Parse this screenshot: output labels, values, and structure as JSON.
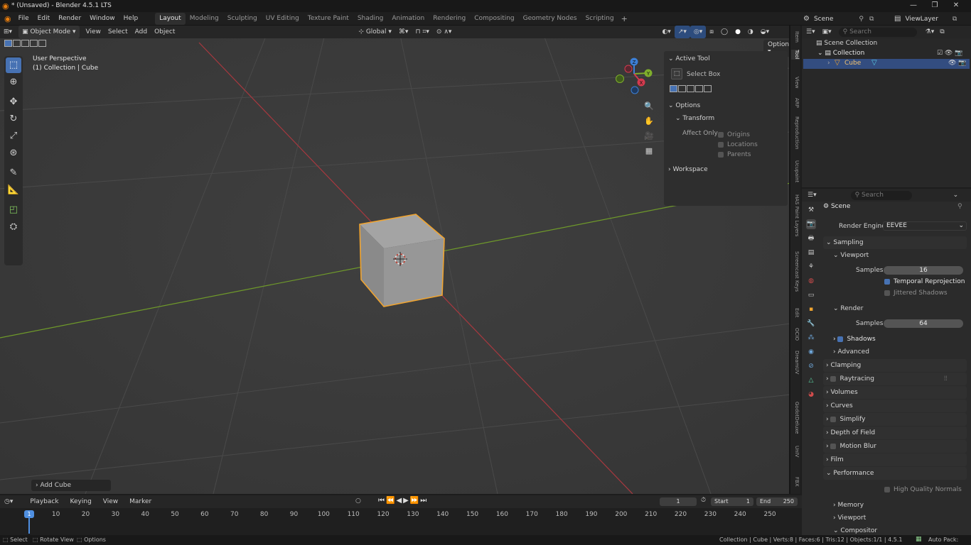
{
  "title": "* (Unsaved) - Blender 4.5.1 LTS",
  "menu": [
    "File",
    "Edit",
    "Render",
    "Window",
    "Help"
  ],
  "workspaces": [
    "Layout",
    "Modeling",
    "Sculpting",
    "UV Editing",
    "Texture Paint",
    "Shading",
    "Animation",
    "Rendering",
    "Compositing",
    "Geometry Nodes",
    "Scripting"
  ],
  "active_workspace": "Layout",
  "scene_label": "Scene",
  "view_layer_label": "ViewLayer",
  "viewport": {
    "mode": "Object Mode",
    "menus": [
      "View",
      "Select",
      "Add",
      "Object"
    ],
    "transform_orientation": "Global",
    "options_label": "Options",
    "perspective": "User Perspective",
    "collection_info": "(1) Collection | Cube",
    "operator_panel": "Add Cube",
    "gizmo_axes": {
      "x": "X",
      "y": "Y",
      "z": "Z"
    }
  },
  "npanel": {
    "active_tool_header": "Active Tool",
    "tool_name": "Select Box",
    "options_header": "Options",
    "transform_header": "Transform",
    "affect_only": "Affect Only",
    "affect_items": [
      "Origins",
      "Locations",
      "Parents"
    ],
    "workspace_header": "Workspace"
  },
  "side_tabs": [
    "Item",
    "Tool",
    "View",
    "ARP",
    "Reproduction",
    "Ucupaint",
    "HAS Paint Layers",
    "Screencast Keys",
    "Edit",
    "OCIO",
    "DreamUV",
    "GodotDeluxe",
    "UnIV",
    "FBX"
  ],
  "outliner": {
    "search_placeholder": "Search",
    "scene_collection": "Scene Collection",
    "collection": "Collection",
    "object": "Cube"
  },
  "properties": {
    "search_placeholder": "Search",
    "scene": "Scene",
    "render_engine_label": "Render Engine",
    "render_engine_value": "EEVEE",
    "sampling": "Sampling",
    "viewport_sub": "Viewport",
    "samples_label": "Samples",
    "viewport_samples": "16",
    "temporal_reprojection": "Temporal Reprojection",
    "jittered_shadows": "Jittered Shadows",
    "render_sub": "Render",
    "render_samples": "64",
    "shadows": "Shadows",
    "advanced": "Advanced",
    "sections": [
      "Clamping",
      "Raytracing",
      "Volumes",
      "Curves",
      "Simplify",
      "Depth of Field",
      "Motion Blur",
      "Film",
      "Performance"
    ],
    "high_quality_normals": "High Quality Normals",
    "perf_subs": [
      "Memory",
      "Viewport",
      "Compositor"
    ]
  },
  "timeline": {
    "menus": [
      "Playback",
      "Keying",
      "View",
      "Marker"
    ],
    "current_frame": "1",
    "start_label": "Start",
    "start_value": "1",
    "end_label": "End",
    "end_value": "250",
    "ticks": [
      "10",
      "20",
      "30",
      "40",
      "50",
      "60",
      "70",
      "80",
      "90",
      "100",
      "110",
      "120",
      "130",
      "140",
      "150",
      "160",
      "170",
      "180",
      "190",
      "200",
      "210",
      "220",
      "230",
      "240",
      "250"
    ]
  },
  "statusbar": {
    "select": "Select",
    "rotate": "Rotate View",
    "options": "Options",
    "stats": "Collection | Cube | Verts:8 | Faces:6 | Tris:12 | Objects:1/1 | 4.5.1",
    "autopack": "Auto Pack:"
  },
  "colors": {
    "accent": "#4772b3",
    "selection_outline": "#f0a430",
    "x_axis": "#d43a4e",
    "y_axis": "#7fae2c",
    "z_axis": "#3c7fd6"
  }
}
